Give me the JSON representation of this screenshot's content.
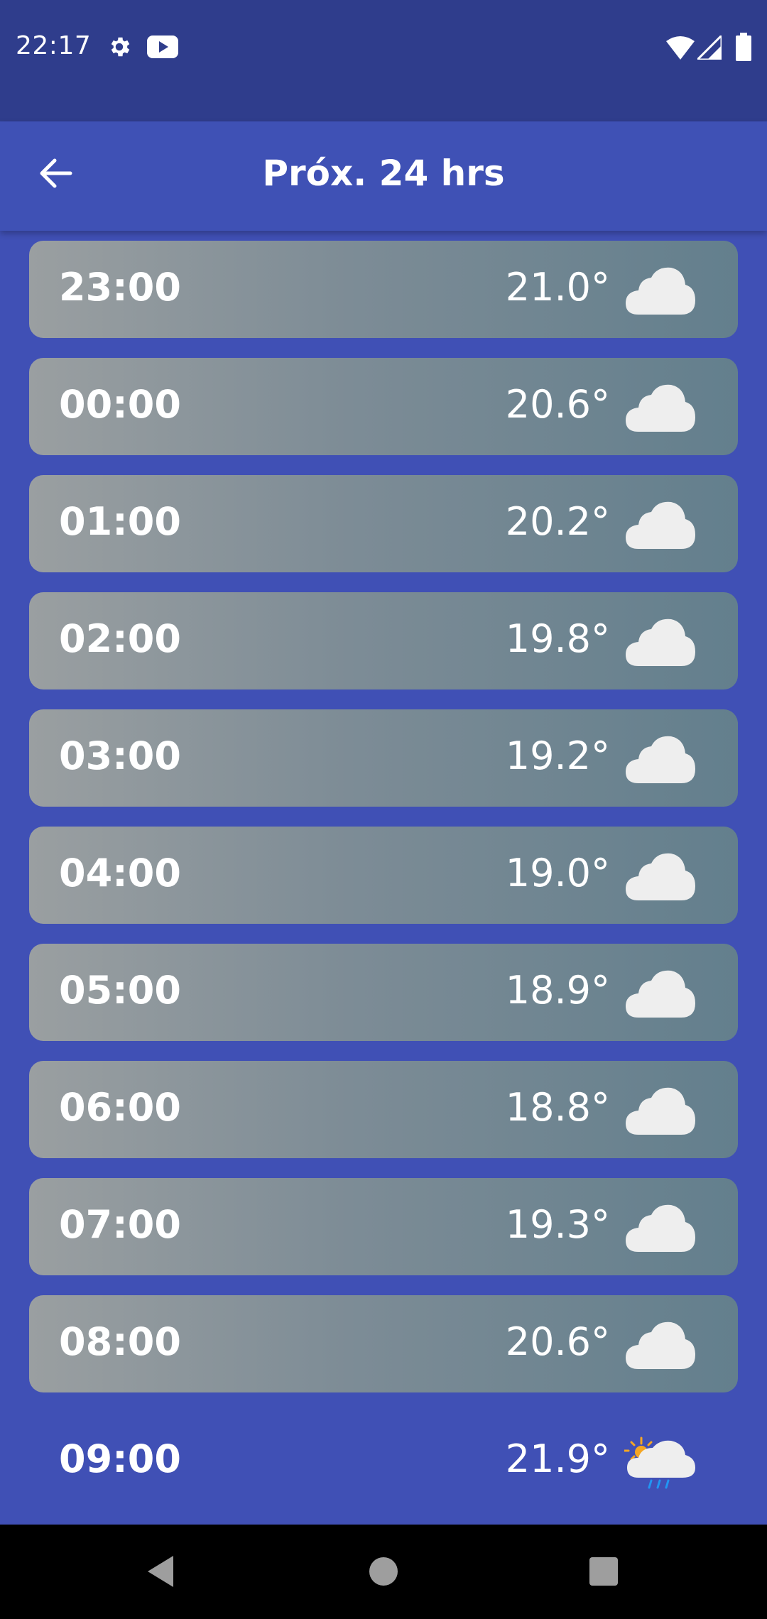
{
  "status_bar": {
    "time": "22:17",
    "left_icons": [
      "gear-icon",
      "youtube-icon"
    ],
    "right_icons": [
      "wifi-icon",
      "signal-icon",
      "battery-icon"
    ]
  },
  "app_bar": {
    "title": "Próx. 24 hrs",
    "back_icon": "arrow-left-icon"
  },
  "hourly": [
    {
      "time": "23:00",
      "temp": "21.0°",
      "icon": "cloud-icon"
    },
    {
      "time": "00:00",
      "temp": "20.6°",
      "icon": "cloud-icon"
    },
    {
      "time": "01:00",
      "temp": "20.2°",
      "icon": "cloud-icon"
    },
    {
      "time": "02:00",
      "temp": "19.8°",
      "icon": "cloud-icon"
    },
    {
      "time": "03:00",
      "temp": "19.2°",
      "icon": "cloud-icon"
    },
    {
      "time": "04:00",
      "temp": "19.0°",
      "icon": "cloud-icon"
    },
    {
      "time": "05:00",
      "temp": "18.9°",
      "icon": "cloud-icon"
    },
    {
      "time": "06:00",
      "temp": "18.8°",
      "icon": "cloud-icon"
    },
    {
      "time": "07:00",
      "temp": "19.3°",
      "icon": "cloud-icon"
    },
    {
      "time": "08:00",
      "temp": "20.6°",
      "icon": "cloud-icon"
    },
    {
      "time": "09:00",
      "temp": "21.9°",
      "icon": "sun-cloud-rain-icon"
    }
  ],
  "colors": {
    "status_bar": "#2f3d8c",
    "app_bar": "#3f51b5",
    "background": "#4050b5",
    "card_gradient_start": "#9a9fa1",
    "card_gradient_end": "#637f8d",
    "cloud": "#eeeeee",
    "sun": "#f5a623",
    "rain": "#2196f3"
  },
  "nav_bar": {
    "buttons": [
      "back-triangle-icon",
      "home-circle-icon",
      "recents-square-icon"
    ]
  }
}
